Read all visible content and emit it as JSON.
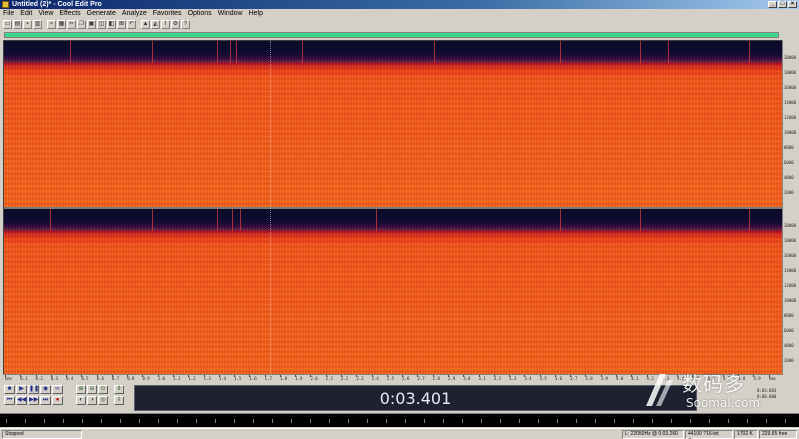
{
  "window": {
    "title": "Untitled (2)* - Cool Edit Pro",
    "controls": [
      "_",
      "□",
      "×"
    ]
  },
  "menu": [
    "File",
    "Edit",
    "View",
    "Effects",
    "Generate",
    "Analyze",
    "Favorites",
    "Options",
    "Window",
    "Help"
  ],
  "display": {
    "time": "0:03.401"
  },
  "freq_ticks_channel1": [
    "20000",
    "18000",
    "16000",
    "14000",
    "12000",
    "10000",
    "8000",
    "6000",
    "4000",
    "2000"
  ],
  "freq_ticks_channel2": [
    "20000",
    "18000",
    "16000",
    "14000",
    "12000",
    "10000",
    "8000",
    "6000",
    "4000",
    "2000"
  ],
  "time_ticks": [
    "hms",
    "0.1",
    "0.2",
    "0.3",
    "0.4",
    "0.5",
    "0.6",
    "0.7",
    "0.8",
    "0.9",
    "1.0",
    "1.1",
    "1.2",
    "1.3",
    "1.4",
    "1.5",
    "1.6",
    "1.7",
    "1.8",
    "1.9",
    "2.0",
    "2.1",
    "2.2",
    "2.3",
    "2.4",
    "2.5",
    "2.6",
    "2.7",
    "2.8",
    "2.9",
    "3.0",
    "3.1",
    "3.2",
    "3.3",
    "3.4",
    "3.5",
    "3.6",
    "3.7",
    "3.8",
    "3.9",
    "4.0",
    "4.1",
    "4.2",
    "4.3",
    "4.4",
    "4.5",
    "4.6",
    "4.7",
    "4.8",
    "4.9",
    "hms"
  ],
  "selection": {
    "begin": "0:03.883",
    "end": "0:00.000"
  },
  "status": {
    "state": "Stopped",
    "cursor": "L: 22050Hz @ 0:03.260",
    "format": "44100 ?16-bit Stereo",
    "size": "1702 K",
    "free": "229.65 free"
  },
  "watermark": {
    "chinese": "数码多",
    "site": "Soomal.com"
  },
  "colors": {
    "accent_overview": "#3cd78c",
    "spectral_low": "#0c0a2c",
    "spectral_high": "#f2641f",
    "time_display_bg": "#1e2130"
  }
}
